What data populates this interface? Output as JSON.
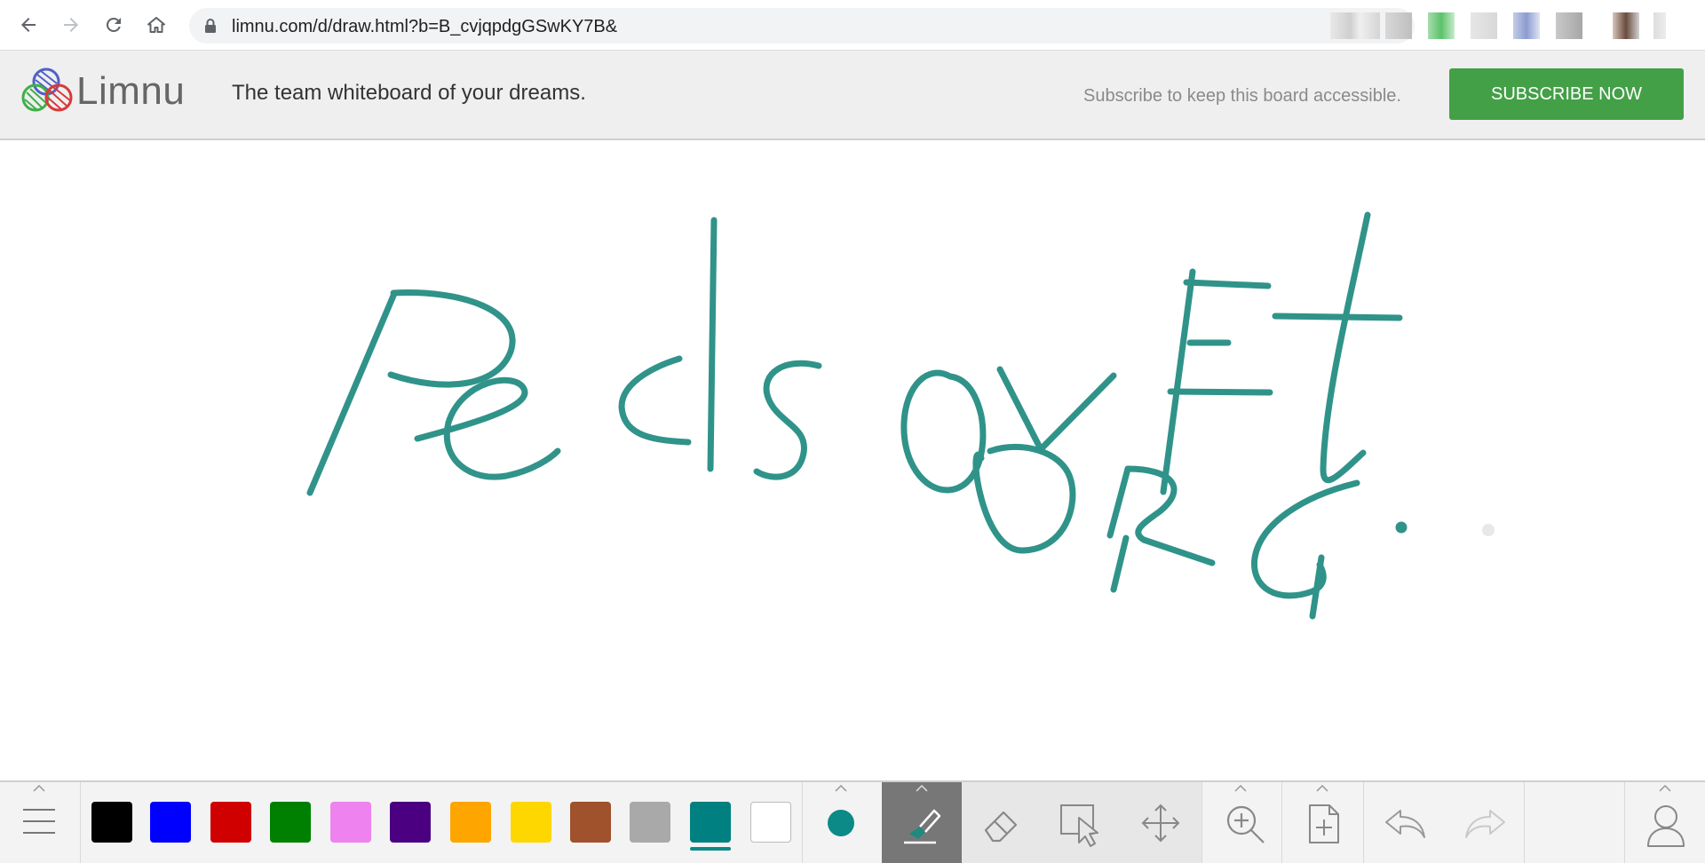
{
  "browser": {
    "url": "limnu.com/d/draw.html?b=B_cvjqpdgGSwKY7B&"
  },
  "header": {
    "logo_text": "Limnu",
    "tagline": "The team whiteboard of your dreams.",
    "subscribe_message": "Subscribe to keep this board accessible.",
    "subscribe_button": "SUBSCRIBE NOW"
  },
  "canvas": {
    "stroke_color": "#1f8a80",
    "handwritten_text": [
      "Pedsovet.",
      "ORG"
    ]
  },
  "toolbar": {
    "colors": [
      {
        "name": "black",
        "hex": "#000000"
      },
      {
        "name": "blue",
        "hex": "#0000ff"
      },
      {
        "name": "red",
        "hex": "#d00000"
      },
      {
        "name": "green",
        "hex": "#008000"
      },
      {
        "name": "pink",
        "hex": "#ee82ee"
      },
      {
        "name": "indigo",
        "hex": "#4b0082"
      },
      {
        "name": "orange",
        "hex": "#ffa500"
      },
      {
        "name": "gold",
        "hex": "#ffd700"
      },
      {
        "name": "sienna",
        "hex": "#a0522d"
      },
      {
        "name": "gray",
        "hex": "#a9a9a9"
      },
      {
        "name": "teal",
        "hex": "#008080"
      },
      {
        "name": "white",
        "hex": "#ffffff"
      }
    ],
    "selected_color": "teal",
    "active_tool": "marker",
    "tools": [
      "menu-icon",
      "brush-size-icon",
      "marker-icon",
      "eraser-icon",
      "select-icon",
      "pan-icon",
      "zoom-icon",
      "add-page-icon",
      "undo-icon",
      "redo-icon",
      "user-icon"
    ]
  }
}
